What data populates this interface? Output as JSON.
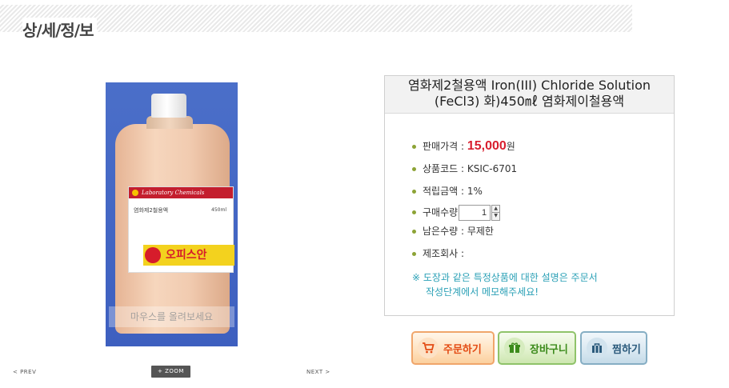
{
  "page": {
    "title": "상/세/정/보"
  },
  "image": {
    "hover_hint": "마우스를 올려보세요",
    "label_header": "Laboratory Chemicals",
    "label_product": "염화제2철용액",
    "label_volume": "450ml",
    "label_brand": "오피스안"
  },
  "nav": {
    "prev": "< PREV",
    "zoom": "+ ZOOM",
    "next": "NEXT >"
  },
  "product": {
    "name_line1": "염화제2철용액 Iron(III) Chloride Solution",
    "name_line2": "(FeCl3) 화)450㎖ 염화제이철용액",
    "price_label": "판매가격 : ",
    "price_value": "15,000",
    "price_unit": "원",
    "code_label": "상품코드 : ",
    "code_value": "KSIC-6701",
    "points_label": "적립금액 : ",
    "points_value": "1%",
    "qty_label": "구매수량",
    "qty_value": "1",
    "stock_label": "남은수량 : ",
    "stock_value": "무제한",
    "maker_label": "제조회사 : ",
    "maker_value": "",
    "notice_line1": "※ 도장과 같은 특정상품에 대한 설명은 주문서",
    "notice_line2": "작성단계에서 메모해주세요!"
  },
  "buttons": {
    "order": "주문하기",
    "cart": "장바구니",
    "wish": "찜하기"
  },
  "icons": {
    "order": "cart-icon",
    "cart": "gift-icon",
    "wish": "bag-icon"
  },
  "colors": {
    "price": "#d81e2e",
    "bullet": "#8ca335",
    "notice": "#2aa0b6"
  }
}
